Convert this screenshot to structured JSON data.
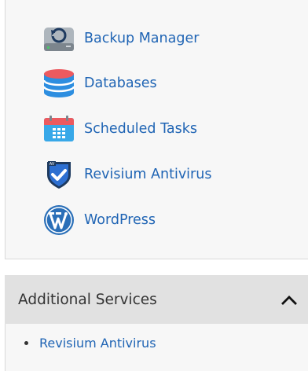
{
  "tools": [
    {
      "label": "Backup Manager",
      "icon": "backup-drive-icon"
    },
    {
      "label": "Databases",
      "icon": "database-icon"
    },
    {
      "label": "Scheduled Tasks",
      "icon": "calendar-icon"
    },
    {
      "label": "Revisium Antivirus",
      "icon": "antivirus-shield-icon"
    },
    {
      "label": "WordPress",
      "icon": "wordpress-icon"
    }
  ],
  "additional_services": {
    "title": "Additional Services",
    "expanded": true,
    "items": [
      {
        "label": "Revisium Antivirus"
      }
    ]
  },
  "colors": {
    "link": "#1f64b4",
    "panel_bg": "#f7f7f7",
    "header_bg": "#e1e1e1",
    "text": "#333333"
  }
}
